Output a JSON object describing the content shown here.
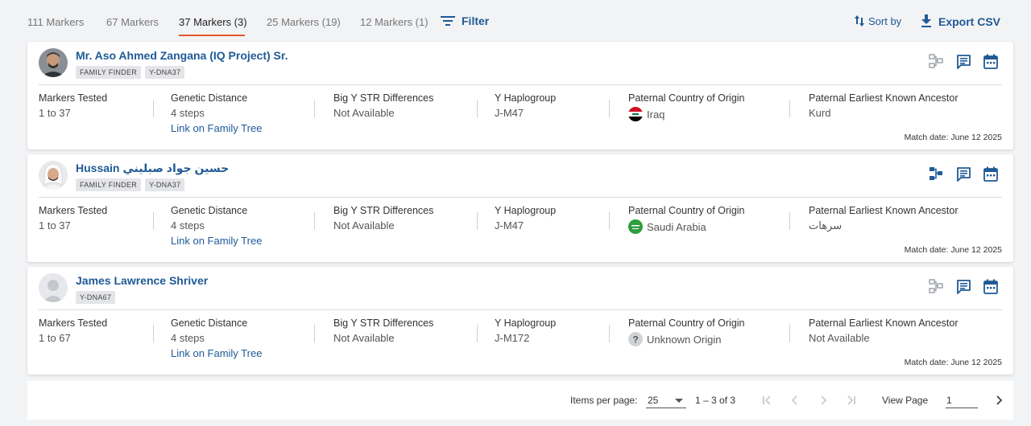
{
  "tabs": [
    {
      "label": "111 Markers",
      "active": false
    },
    {
      "label": "67 Markers",
      "active": false
    },
    {
      "label": "37 Markers (3)",
      "active": true
    },
    {
      "label": "25 Markers (19)",
      "active": false
    },
    {
      "label": "12 Markers (1)",
      "active": false
    }
  ],
  "toolbar": {
    "filter_label": "Filter",
    "sort_label": "Sort by",
    "export_label": "Export CSV"
  },
  "columns": {
    "markers": "Markers Tested",
    "distance": "Genetic Distance",
    "bigy": "Big Y STR Differences",
    "haplogroup": "Y Haplogroup",
    "country": "Paternal Country of Origin",
    "ancestor": "Paternal Earliest Known Ancestor"
  },
  "matches": [
    {
      "name": "Mr. Aso Ahmed Zangana (IQ Project) Sr.",
      "badges": [
        "FAMILY FINDER",
        "Y-DNA37"
      ],
      "markers": "1 to 37",
      "distance": "4 steps",
      "tree_link": "Link on Family Tree",
      "bigy": "Not Available",
      "haplogroup": "J-M47",
      "country": "Iraq",
      "ancestor": "Kurd",
      "match_date": "Match date: June 12 2025"
    },
    {
      "name": "Hussain حسين جواد صبليني",
      "badges": [
        "FAMILY FINDER",
        "Y-DNA37"
      ],
      "markers": "1 to 37",
      "distance": "4 steps",
      "tree_link": "Link on Family Tree",
      "bigy": "Not Available",
      "haplogroup": "J-M47",
      "country": "Saudi Arabia",
      "ancestor": "سرهات",
      "match_date": "Match date: June 12 2025"
    },
    {
      "name": "James Lawrence Shriver",
      "badges": [
        "Y-DNA67"
      ],
      "markers": "1 to 67",
      "distance": "4 steps",
      "tree_link": "Link on Family Tree",
      "bigy": "Not Available",
      "haplogroup": "J-M172",
      "country": "Unknown Origin",
      "ancestor": "Not Available",
      "match_date": "Match date: June 12 2025"
    }
  ],
  "pagination": {
    "items_per_page_label": "Items per page:",
    "items_per_page": "25",
    "range": "1 – 3 of 3",
    "view_page_label": "View Page",
    "page": "1"
  },
  "colors": {
    "accent": "#1f5a96",
    "tab_underline": "#e2562c",
    "background": "#f2f3f5"
  }
}
